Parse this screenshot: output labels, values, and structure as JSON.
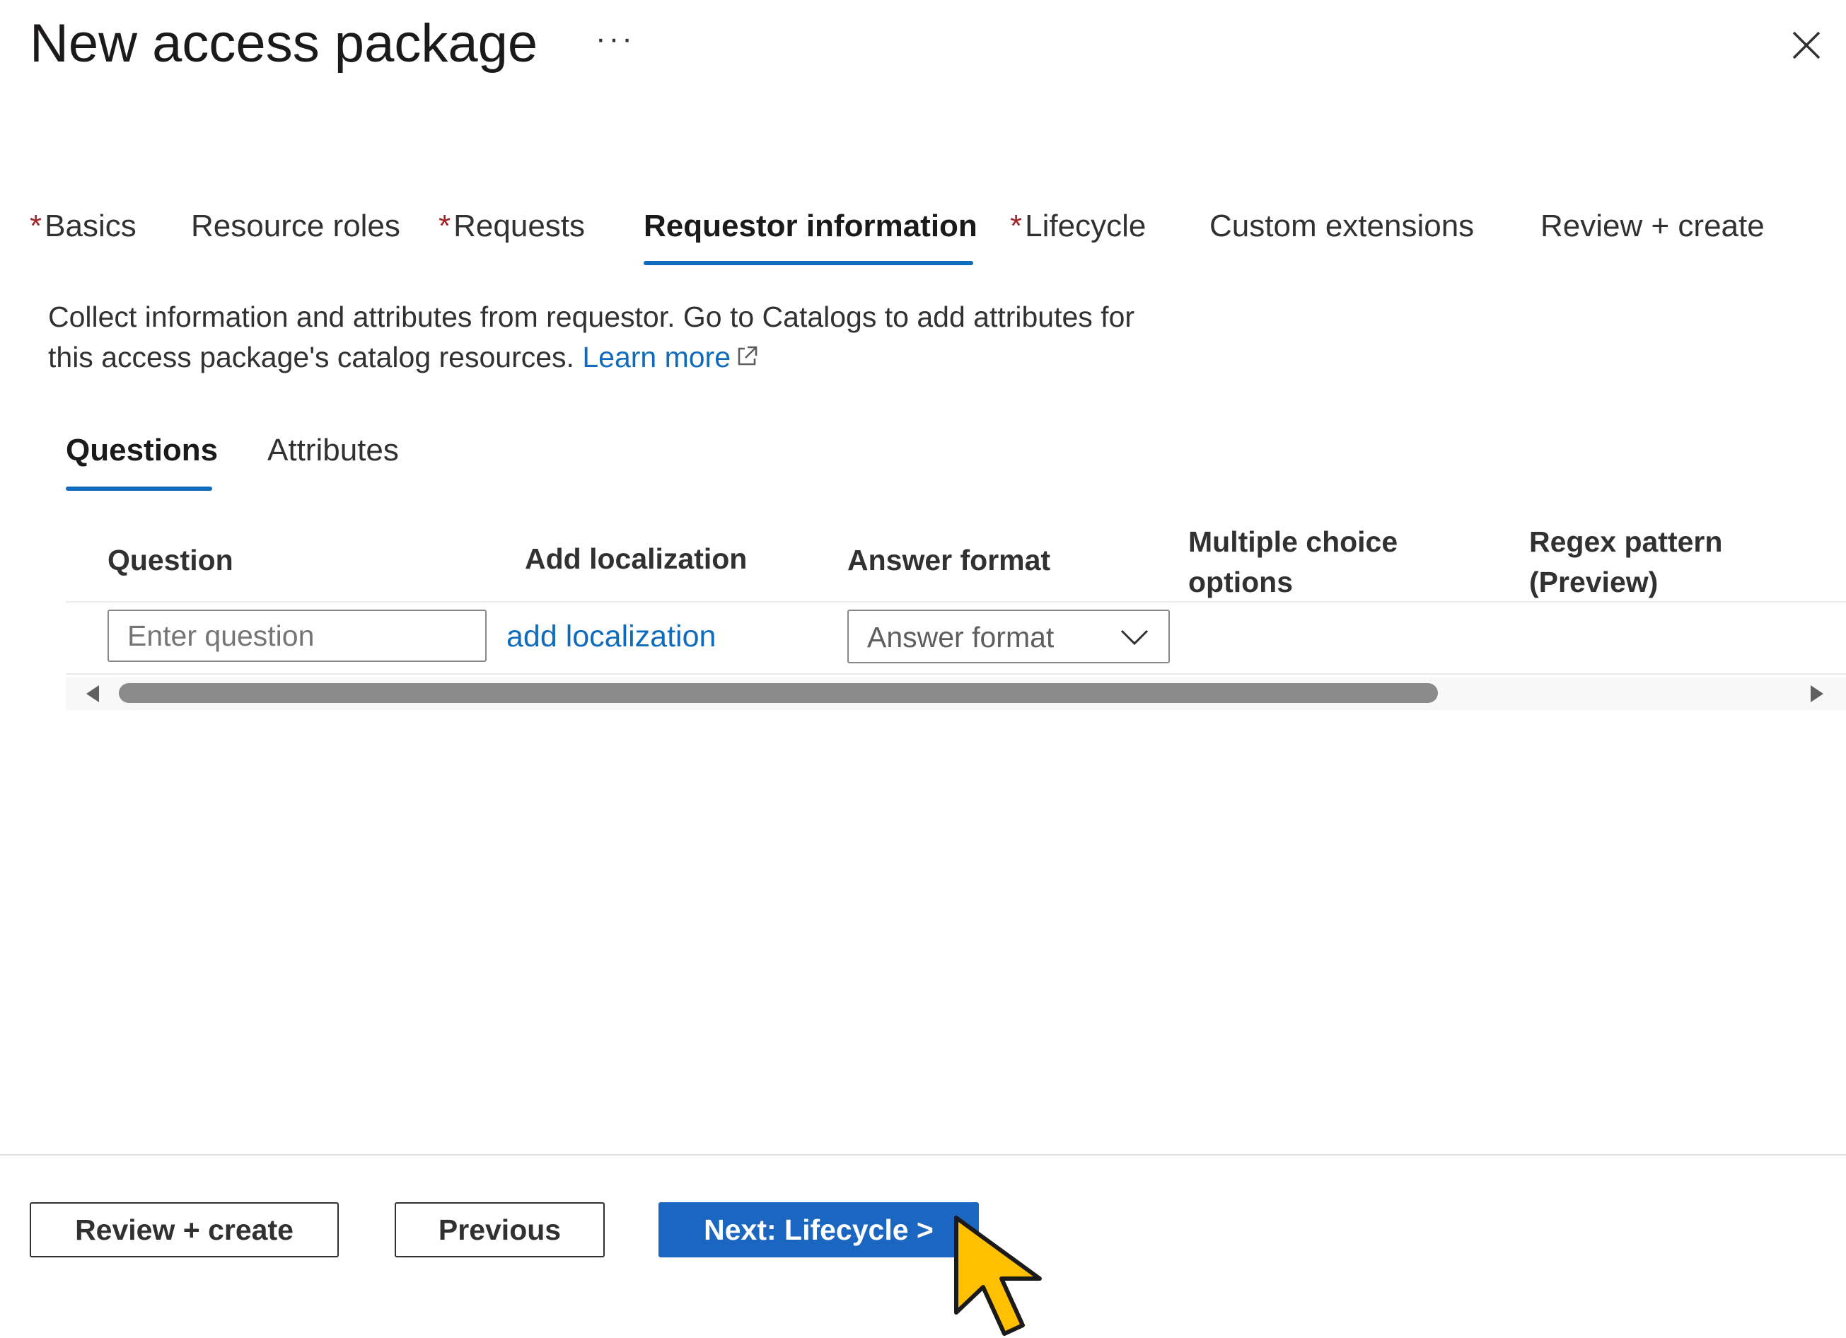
{
  "header": {
    "title": "New access package",
    "more_label": "···"
  },
  "wizard_tabs": [
    {
      "label": "Basics",
      "required": "*"
    },
    {
      "label": "Resource roles"
    },
    {
      "label": "Requests",
      "required": "*"
    },
    {
      "label": "Requestor information",
      "active": true
    },
    {
      "label": "Lifecycle",
      "required": "*"
    },
    {
      "label": "Custom extensions"
    },
    {
      "label": "Review + create"
    }
  ],
  "description": {
    "line1": "Collect information and attributes from requestor. Go to Catalogs to add attributes for",
    "line2": "this access package's catalog resources.",
    "learn_more": "Learn more"
  },
  "sub_tabs": [
    {
      "label": "Questions",
      "active": true
    },
    {
      "label": "Attributes"
    }
  ],
  "table": {
    "headers": [
      "Question",
      "Add localization",
      "Answer format",
      "Multiple choice",
      "options",
      "Regex pattern",
      "(Preview)"
    ],
    "row": {
      "question_placeholder": "Enter question",
      "localization_link": "add localization",
      "answer_format": "Answer format"
    }
  },
  "footer": {
    "review_create": "Review + create",
    "previous": "Previous",
    "next": "Next: Lifecycle >"
  },
  "colors": {
    "accent": "#0f6cbd",
    "primary_button": "#1a66c0",
    "required": "#a4262c",
    "cursor": "#ffc000"
  }
}
